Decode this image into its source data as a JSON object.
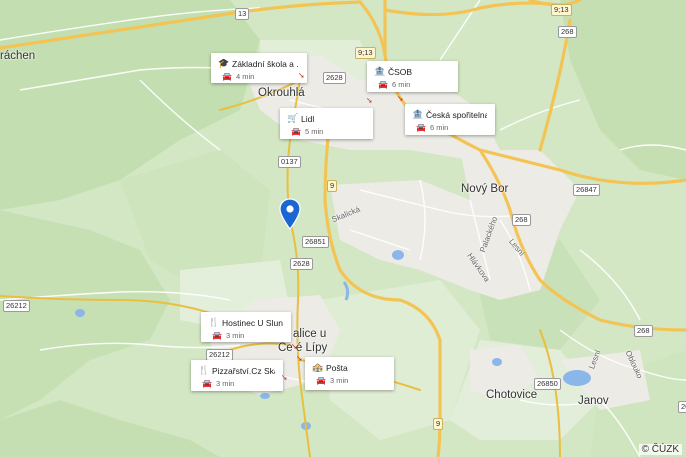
{
  "map": {
    "colors": {
      "forest": "#c6e0b4",
      "meadow": "#e3eeda",
      "urban": "#efeeea",
      "water": "#8ab6ea",
      "road_major": "#f6cb5c",
      "road_minor": "#ffffff",
      "pin": "#1a66d2"
    },
    "places": {
      "rachen": "ráchen",
      "okrouhla": "Okrouhlá",
      "novy_bor": "Nový Bor",
      "chotovice": "Chotovice",
      "janov": "Janov",
      "sloup_line1": "alice u",
      "sloup_line2": "Ce   é Lípy"
    },
    "streets": {
      "skalicka": "Skalická",
      "palackeho": "Palackého",
      "lesni": "Lesní",
      "hlavni": "Hlávkova",
      "lesni2": "Lesní",
      "oblouk": "Obloukо"
    },
    "roads": {
      "r13": "13",
      "r913_top": "9;13",
      "r913": "9;13",
      "r268_top": "268",
      "r2628_a": "2628",
      "r0137": "0137",
      "r9": "9",
      "r26851": "26851",
      "r2628_b": "2628",
      "r26847": "26847",
      "r268_b": "268",
      "r26212_w": "26212",
      "r26212": "26212",
      "r268_c": "268",
      "r26850": "26850",
      "r268_d": "268",
      "r9_low": "9"
    },
    "attribution": "© ČÚZK"
  },
  "pois": [
    {
      "title": "Základní škola a ...",
      "time": "4 min",
      "icon": "graduation-cap-icon",
      "glyph": "🎓"
    },
    {
      "title": "ČSOB",
      "time": "6 min",
      "icon": "bank-icon",
      "glyph": "🏦"
    },
    {
      "title": "Lidl",
      "time": "5 min",
      "icon": "shopping-cart-icon",
      "glyph": "🛒"
    },
    {
      "title": "Česká spořitelna",
      "time": "6 min",
      "icon": "bank-icon",
      "glyph": "🏦"
    },
    {
      "title": "Hostinec U Slunce",
      "time": "3 min",
      "icon": "fork-knife-icon",
      "glyph": "🍴"
    },
    {
      "title": "Pizzařství.Cz Skali...",
      "time": "3 min",
      "icon": "fork-knife-icon",
      "glyph": "🍴"
    },
    {
      "title": "Pošta",
      "time": "3 min",
      "icon": "post-office-icon",
      "glyph": "🏤"
    }
  ],
  "car_icon": "🚘",
  "arrow_glyph": "➘"
}
